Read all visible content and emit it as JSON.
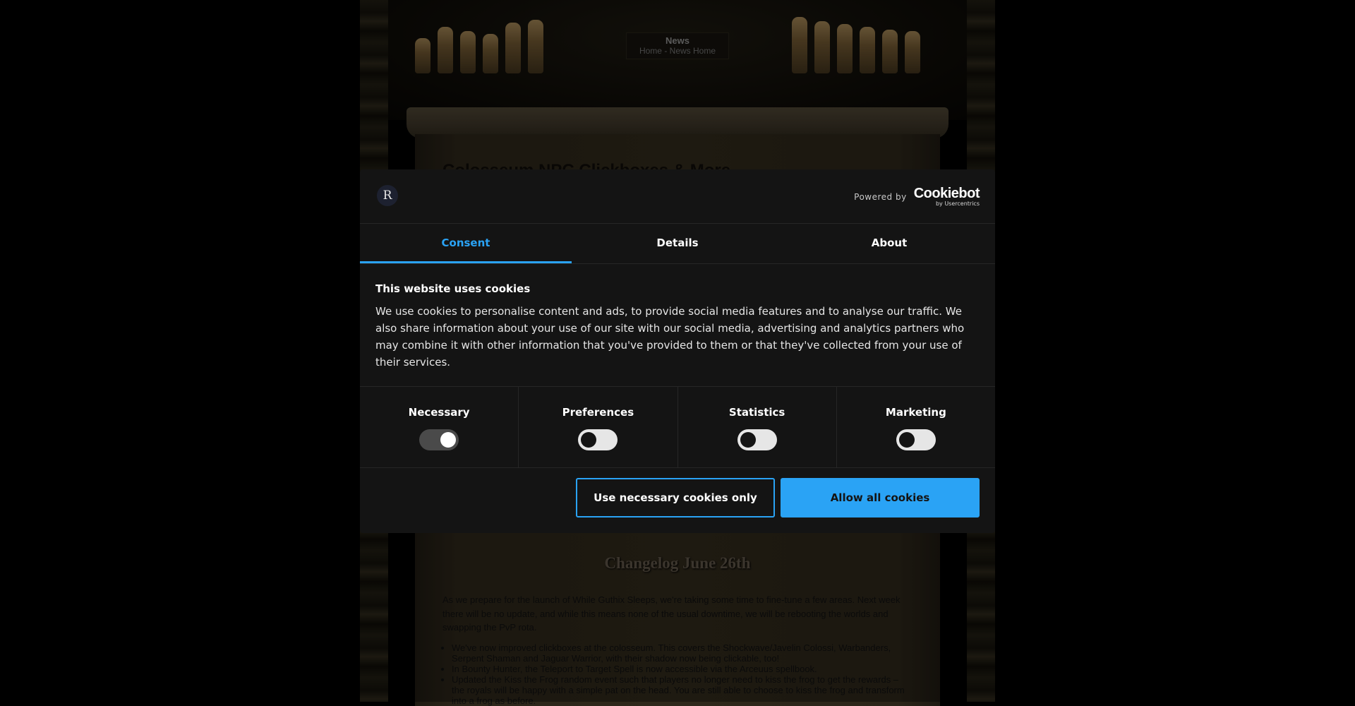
{
  "page": {
    "news_title": "News",
    "breadcrumb": {
      "home": "Home",
      "separator": " - ",
      "news_home": "News Home"
    },
    "article_title": "Colosseum NPC Clickboxes & More",
    "changelog_heading": "Changelog June 26th",
    "intro": "As we prepare for the launch of While Guthix Sleeps, we're taking some time to fine-tune a few areas. Next week there will be no update, and while this means none of the usual downtime, we will be rebooting the worlds and swapping the PvP rota.",
    "bullets": [
      "We've now improved clickboxes at the colosseum. This covers the Shockwave/Javelin Colossi, Warbanders, Serpent Shaman and Jaguar Warrior, with their shadow now being clickable, too!",
      "In Bounty Hunter, the Teleport to Target Spell is now accessible via the Arceuus spellbook.",
      "Updated the Kiss the Frog random event such that players no longer need to kiss the frog to get the rewards – the royals will be happy with a simple pat on the head. You are still able to choose to kiss the frog and transform into a frog as before."
    ]
  },
  "cookie_dialog": {
    "logo_letter": "R",
    "powered_by": "Powered by",
    "brand_name": "Cookiebot",
    "brand_sub": "by Usercentrics",
    "tabs": [
      {
        "label": "Consent",
        "active": true
      },
      {
        "label": "Details",
        "active": false
      },
      {
        "label": "About",
        "active": false
      }
    ],
    "heading": "This website uses cookies",
    "text": "We use cookies to personalise content and ads, to provide social media features and to analyse our traffic. We also share information about your use of our site with our social media, advertising and analytics partners who may combine it with other information that you've provided to them or that they've collected from your use of their services.",
    "toggles": [
      {
        "label": "Necessary",
        "on": true,
        "disabled": true
      },
      {
        "label": "Preferences",
        "on": false,
        "disabled": false
      },
      {
        "label": "Statistics",
        "on": false,
        "disabled": false
      },
      {
        "label": "Marketing",
        "on": false,
        "disabled": false
      }
    ],
    "buttons": {
      "necessary_only": "Use necessary cookies only",
      "allow_all": "Allow all cookies"
    },
    "colors": {
      "accent": "#2aa3f5",
      "background": "#141414"
    }
  }
}
